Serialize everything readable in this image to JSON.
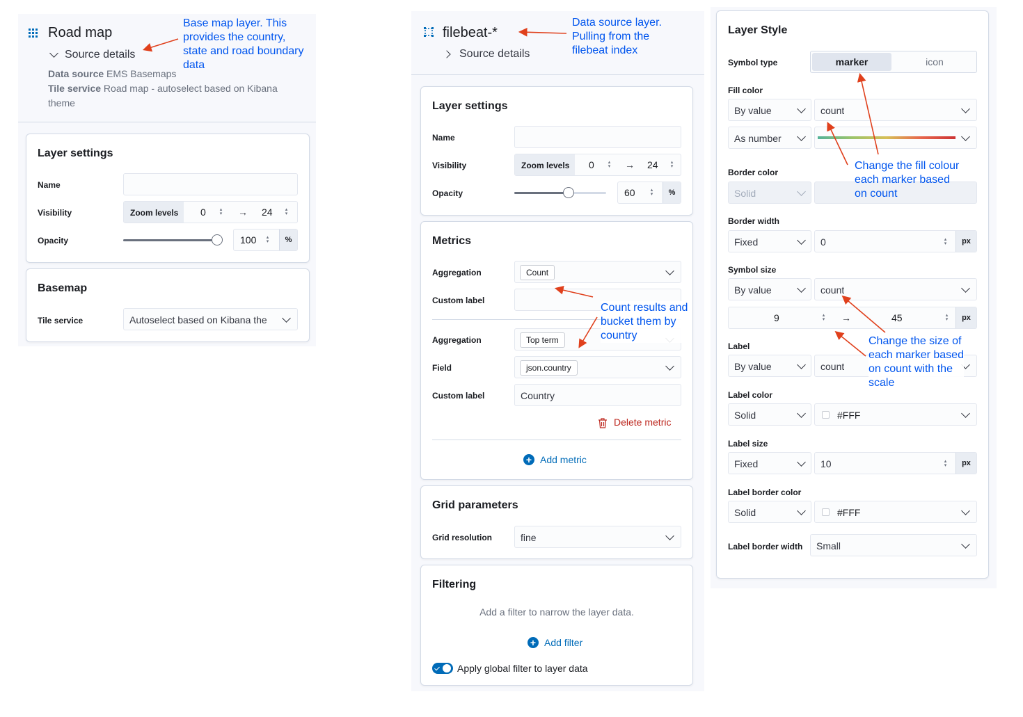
{
  "road_map": {
    "title": "Road map",
    "source_details_label": "Source details",
    "data_source_key": "Data source",
    "data_source_value": "EMS Basemaps",
    "tile_service_key": "Tile service",
    "tile_service_value": "Road map - autoselect based on Kibana",
    "tile_service_value2": "theme",
    "layer_settings": {
      "title": "Layer settings",
      "name_label": "Name",
      "name_value": "",
      "visibility_label": "Visibility",
      "zoom_levels_label": "Zoom levels",
      "zoom_min": "0",
      "zoom_max": "24",
      "arrow": "→",
      "opacity_label": "Opacity",
      "opacity_value": "100",
      "opacity_unit": "%",
      "opacity_fraction": 1.0
    },
    "basemap": {
      "title": "Basemap",
      "tile_service_label": "Tile service",
      "tile_service_value": "Autoselect based on Kibana the"
    }
  },
  "filebeat": {
    "title": "filebeat-*",
    "source_details_label": "Source details",
    "layer_settings": {
      "title": "Layer settings",
      "name_label": "Name",
      "name_value": "",
      "visibility_label": "Visibility",
      "zoom_levels_label": "Zoom levels",
      "zoom_min": "0",
      "zoom_max": "24",
      "arrow": "→",
      "opacity_label": "Opacity",
      "opacity_value": "60",
      "opacity_unit": "%",
      "opacity_fraction": 0.6
    },
    "metrics": {
      "title": "Metrics",
      "aggregation_label": "Aggregation",
      "aggregation_1": "Count",
      "custom_label_label": "Custom label",
      "custom_label_1": "",
      "aggregation_2": "Top term",
      "field_label": "Field",
      "field_value": "json.country",
      "custom_label_2": "Country",
      "delete_metric": "Delete metric",
      "add_metric": "Add metric"
    },
    "grid": {
      "title": "Grid parameters",
      "resolution_label": "Grid resolution",
      "resolution_value": "fine"
    },
    "filtering": {
      "title": "Filtering",
      "hint": "Add a filter to narrow the layer data.",
      "add_filter": "Add filter",
      "apply_global": "Apply global filter to layer data",
      "apply_global_on": true
    }
  },
  "layer_style": {
    "title": "Layer Style",
    "symbol_type_label": "Symbol type",
    "symbol_marker": "marker",
    "symbol_icon": "icon",
    "fill_color_label": "Fill color",
    "fill_by": "By value",
    "fill_field": "count",
    "fill_as": "As number",
    "border_color_label": "Border color",
    "border_color_mode": "Solid",
    "border_width_label": "Border width",
    "border_width_mode": "Fixed",
    "border_width_value": "0",
    "px": "px",
    "symbol_size_label": "Symbol size",
    "symbol_size_by": "By value",
    "symbol_size_field": "count",
    "symbol_size_min": "9",
    "symbol_size_max": "45",
    "arrow": "→",
    "label_label": "Label",
    "label_by": "By value",
    "label_field": "count",
    "label_color_label": "Label color",
    "label_color_mode": "Solid",
    "label_color_value": "#FFF",
    "label_size_label": "Label size",
    "label_size_mode": "Fixed",
    "label_size_value": "10",
    "label_border_color_label": "Label border color",
    "label_border_color_mode": "Solid",
    "label_border_color_value": "#FFF",
    "label_border_width_label": "Label border width",
    "label_border_width_value": "Small"
  },
  "annotations": {
    "basemap_line1": "Base map layer. This",
    "basemap_line2": "provides the country,",
    "basemap_line3": "state and road boundary",
    "basemap_line4": "data",
    "datasource_line1": "Data source layer.",
    "datasource_line2": "Pulling from the",
    "datasource_line3": "filebeat index",
    "count_line1": "Count results and",
    "count_line2": "bucket them by",
    "count_line3": "country",
    "fill_line1": "Change the fill colour",
    "fill_line2": "each marker based",
    "fill_line3": "on count",
    "size_line1": "Change the size of",
    "size_line2": "each marker based",
    "size_line3": "on count with the",
    "size_line4": "scale"
  },
  "colors": {
    "annotation_text": "#0055ee",
    "annotation_arrow": "#e0401c",
    "link_blue": "#006bb8",
    "danger_red": "#bd271e"
  },
  "icons": [
    "grid-icon",
    "bounding-box-icon",
    "chevron-down-icon",
    "chevron-right-icon",
    "trash-icon",
    "plus-circle-icon",
    "toggle-switch"
  ]
}
